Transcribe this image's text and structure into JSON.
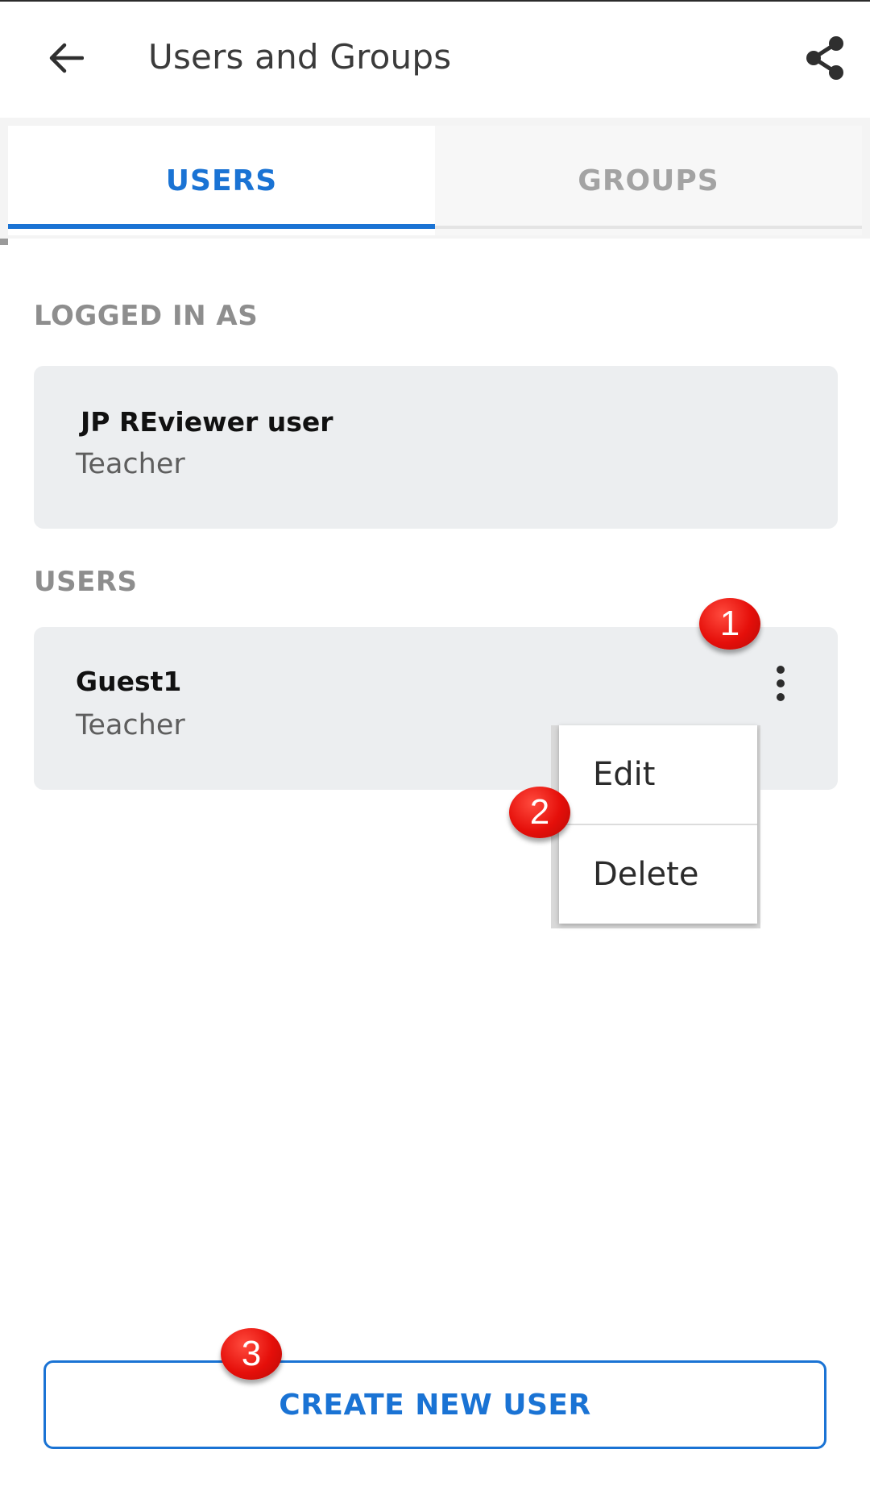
{
  "appbar": {
    "title": "Users and Groups",
    "back_icon": "arrow-left-icon",
    "share_icon": "share-icon"
  },
  "tabs": [
    {
      "label": "USERS",
      "active": true
    },
    {
      "label": "GROUPS",
      "active": false
    }
  ],
  "logged_in": {
    "section_label": "LOGGED IN AS",
    "name": "JP REviewer user",
    "role": "Teacher"
  },
  "users": {
    "section_label": "USERS",
    "items": [
      {
        "name": "Guest1",
        "role": "Teacher",
        "menu_icon": "more-vertical-icon"
      }
    ]
  },
  "context_menu": {
    "items": [
      "Edit",
      "Delete"
    ]
  },
  "badges": [
    "1",
    "2",
    "3"
  ],
  "create_button": {
    "label": "CREATE NEW USER"
  },
  "colors": {
    "accent": "#1a73d4",
    "badge": "#e50f0a",
    "card_bg": "#eceef0"
  }
}
